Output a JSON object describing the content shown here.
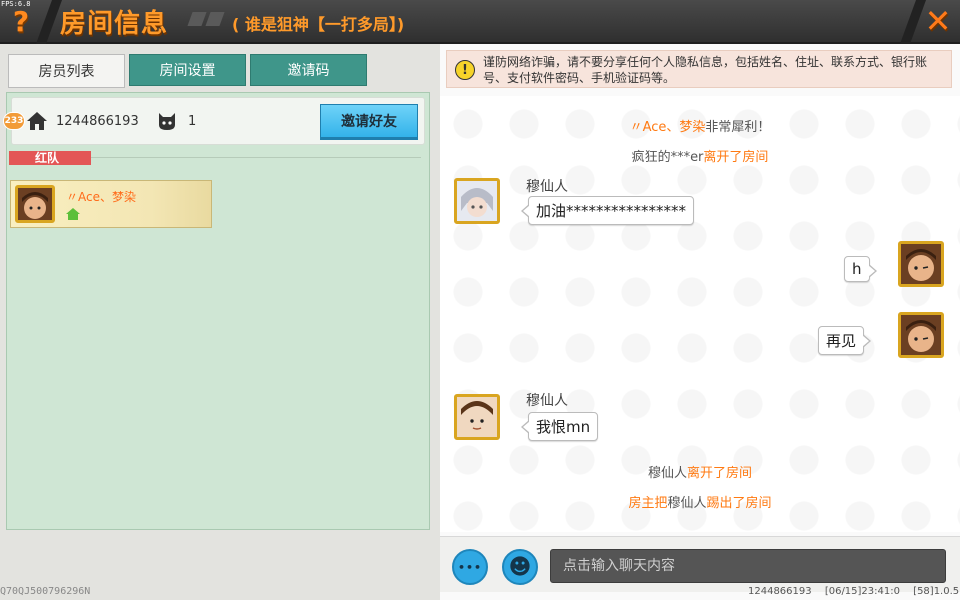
{
  "header": {
    "fps": "FPS:6.8",
    "help_icon": "?",
    "title": "房间信息",
    "subtitle": "( 谁是狙神【一打多局】)",
    "close_icon": "✕"
  },
  "left_panel": {
    "tabs": [
      {
        "label": "房员列表",
        "active": true
      },
      {
        "label": "房间设置",
        "active": false
      },
      {
        "label": "邀请码",
        "active": false
      }
    ],
    "badge": "233",
    "room_id": "1244866193",
    "people_count": "1",
    "invite_button": "邀请好友",
    "team_label": "红队",
    "members": [
      {
        "name": "〃Ace、梦染",
        "is_host": true
      }
    ]
  },
  "right_panel": {
    "warning": "谨防网络诈骗，请不要分享任何个人隐私信息，包括姓名、住址、联系方式、银行账号、支付软件密码、手机验证码等。",
    "chat": {
      "sys1_name": "〃Ace、梦染",
      "sys1_text": "非常犀利！",
      "sys2_name": "疯狂的***er",
      "sys2_text": "离开了房间",
      "msg1_sender": "穆仙人",
      "msg1_text": "加油****************",
      "msg2_text": "h",
      "msg3_text": "再见",
      "msg4_sender": "穆仙人",
      "msg4_text": "我恨mn",
      "sys3_name": "穆仙人",
      "sys3_text": "离开了房间",
      "sys4_part1": "房主把",
      "sys4_name": "穆仙人",
      "sys4_part2": "踢出了房间"
    },
    "input": {
      "placeholder": "点击输入聊天内容",
      "more_icon": "•••",
      "emoji_icon": "☻"
    }
  },
  "footer": {
    "left": "Q70QJ500796296N",
    "room_id": "1244866193",
    "datetime": "[06/15]23:41:0",
    "version": "[58]1.0.5"
  }
}
